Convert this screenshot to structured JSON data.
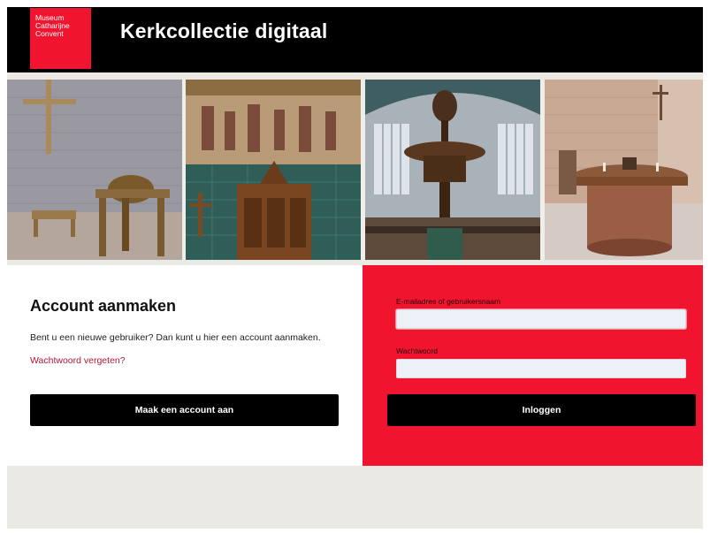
{
  "header": {
    "logo_lines": [
      "Museum",
      "Catharijne",
      "Convent"
    ],
    "title": "Kerkcollectie digitaal"
  },
  "photos": [
    {
      "icon": "church-interior-cross-photo"
    },
    {
      "icon": "mural-and-organ-photo"
    },
    {
      "icon": "pulpit-photo"
    },
    {
      "icon": "altar-photo"
    }
  ],
  "create_account": {
    "title": "Account aanmaken",
    "text": "Bent u een nieuwe gebruiker? Dan kunt u hier een account aanmaken.",
    "forgot_link": "Wachtwoord vergeten?",
    "button_label": "Maak een account aan"
  },
  "login": {
    "email_label": "E-mailadres of gebruikersnaam",
    "email_value": "",
    "password_label": "Wachtwoord",
    "password_value": "",
    "button_label": "Inloggen"
  },
  "colors": {
    "brand_red": "#f0142f",
    "header_black": "#000000",
    "link_color": "#b0163d"
  }
}
